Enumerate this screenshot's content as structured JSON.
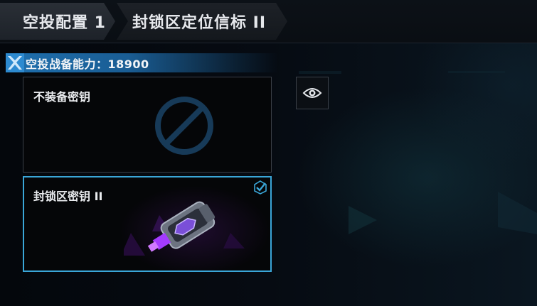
{
  "breadcrumb": {
    "items": [
      {
        "label": "空投配置 1"
      },
      {
        "label": "封锁区定位信标 II"
      }
    ]
  },
  "power": {
    "label": "空投战备能力：18900"
  },
  "options": [
    {
      "label": "不装备密钥",
      "icon": "forbidden-icon",
      "selected": false
    },
    {
      "label": "封锁区密钥 II",
      "icon": "purple-keycard",
      "selected": true
    }
  ],
  "colors": {
    "accent_blue": "#3aa6d8",
    "bar_blue": "#1e6fae",
    "key_purple": "#9b3ff0"
  },
  "icons": {
    "preview": "eye-icon",
    "selected": "check-icon"
  }
}
